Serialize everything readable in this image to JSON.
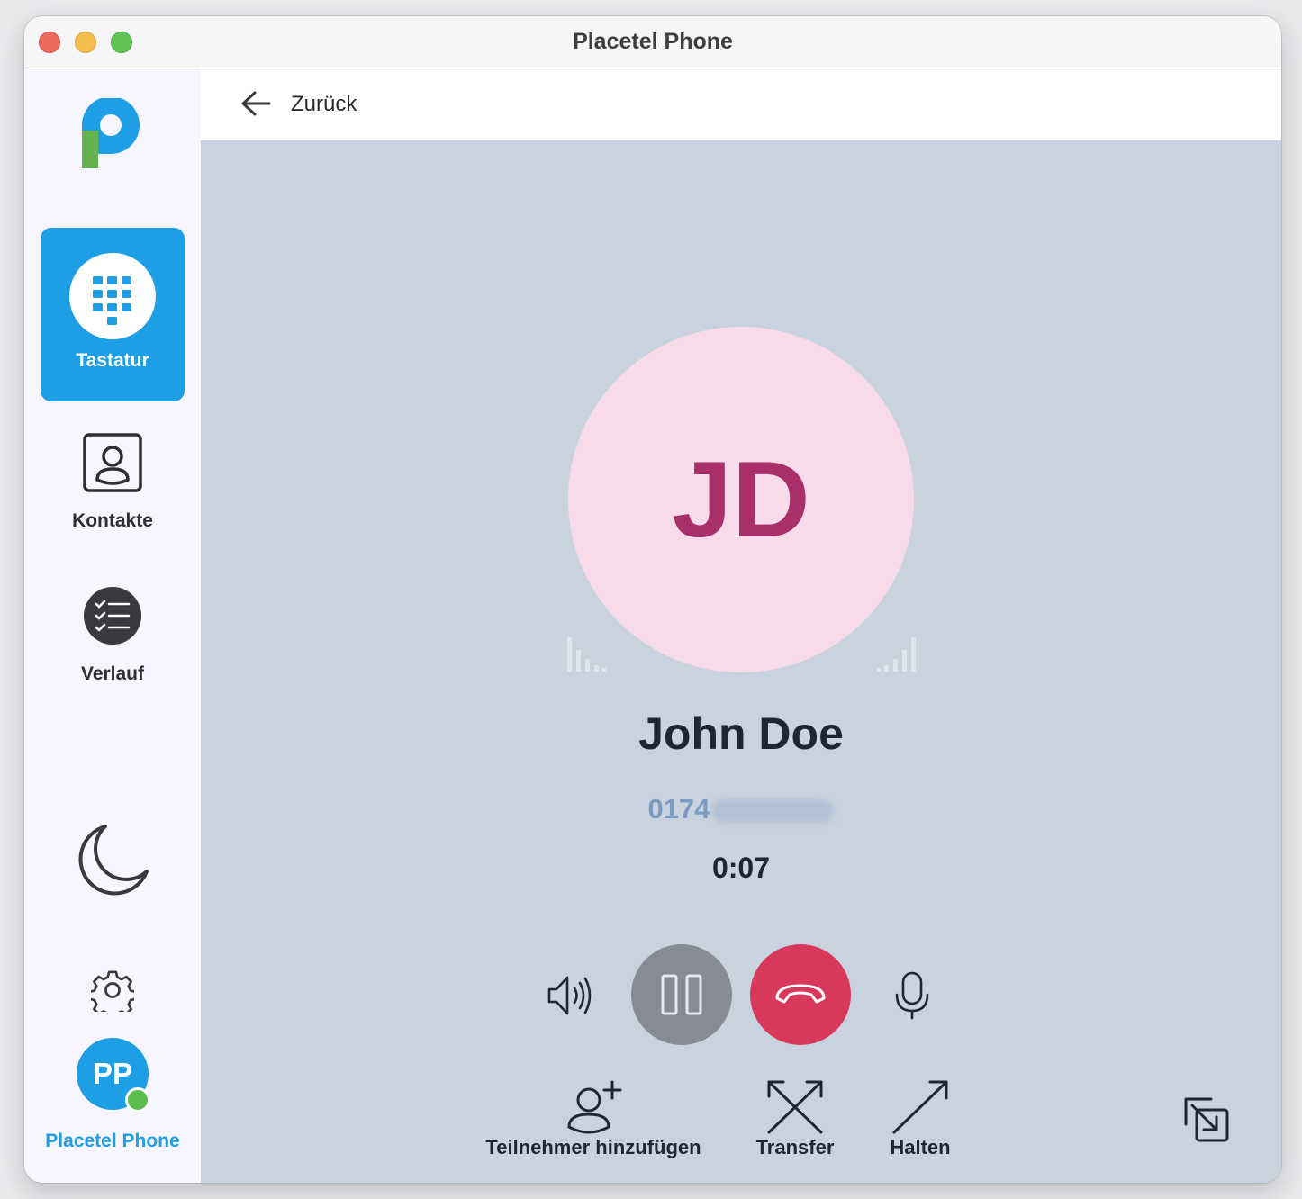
{
  "window": {
    "title": "Placetel Phone"
  },
  "sidebar": {
    "items": [
      {
        "label": "Tastatur",
        "icon": "dialpad-icon",
        "active": true
      },
      {
        "label": "Kontakte",
        "icon": "contacts-icon",
        "active": false
      },
      {
        "label": "Verlauf",
        "icon": "history-icon",
        "active": false
      }
    ],
    "user": {
      "initials": "PP",
      "name": "Placetel Phone",
      "status": "online"
    }
  },
  "topbar": {
    "back_label": "Zurück"
  },
  "call": {
    "initials": "JD",
    "name": "John Doe",
    "number_visible": "0174",
    "timer": "0:07"
  },
  "actions": {
    "add_participant": "Teilnehmer hinzufügen",
    "transfer": "Transfer",
    "hold": "Halten"
  },
  "colors": {
    "accent": "#1e9ee4",
    "hangup": "#d8395a",
    "pause": "#868b95",
    "call_background": "#c9d3df",
    "avatar_bg": "#f7dbe8",
    "avatar_text": "#a82f6a",
    "online": "#5bbd4b"
  }
}
